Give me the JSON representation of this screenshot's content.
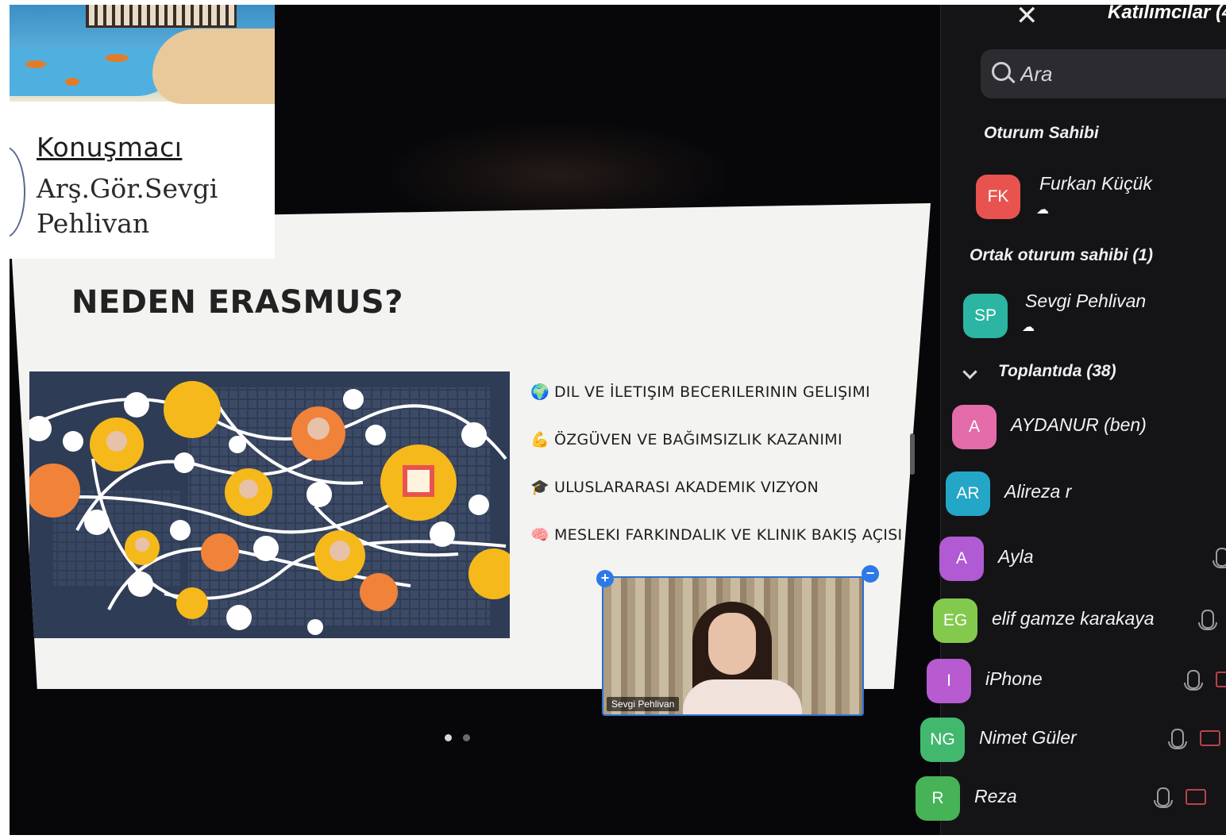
{
  "speaker_card": {
    "label": "Konuşmacı",
    "name": "Arş.Gör.Sevgi Pehlivan"
  },
  "slide": {
    "title": "NEDEN ERASMUS?",
    "bullets": [
      {
        "emoji": "🌍",
        "text": "DIL VE İLETIŞIM BECERILERININ GELIŞIMI"
      },
      {
        "emoji": "💪",
        "text": "ÖZGÜVEN VE BAĞIMSIZLIK KAZANIMI"
      },
      {
        "emoji": "🎓",
        "text": "ULUSLARARASI AKADEMIK VIZYON"
      },
      {
        "emoji": "🧠",
        "text": "MESLEKI FARKINDALIK VE KLINIK BAKIŞ AÇISI"
      }
    ],
    "page_dots": {
      "total": 2,
      "active": 1
    }
  },
  "self_video": {
    "name": "Sevgi Pehlivan",
    "add_glyph": "+",
    "minimize_glyph": "−"
  },
  "participants_panel": {
    "close_glyph": "✕",
    "title": "Katılımcılar (4",
    "search_placeholder": "Ara",
    "host_section": "Oturum Sahibi",
    "cohost_section": "Ortak oturum sahibi (1)",
    "meeting_section": "Toplantıda (38)",
    "host": {
      "initials": "FK",
      "name": "Furkan Küçük",
      "color": "#e8534f"
    },
    "cohost": {
      "initials": "SP",
      "name": "Sevgi Pehlivan",
      "color": "#2bb5a2"
    },
    "members": [
      {
        "initials": "A",
        "name": "AYDANUR (ben)",
        "color": "#e46ba9",
        "mic": false,
        "cam": false
      },
      {
        "initials": "AR",
        "name": "Alireza r",
        "color": "#24a6c6",
        "mic": true,
        "cam": false
      },
      {
        "initials": "A",
        "name": "Ayla",
        "color": "#b05ad3",
        "mic": true,
        "cam": false
      },
      {
        "initials": "EG",
        "name": "elif gamze karakaya",
        "color": "#83c94e",
        "mic": true,
        "cam": false
      },
      {
        "initials": "I",
        "name": "iPhone",
        "color": "#b85ad0",
        "mic": true,
        "cam": true
      },
      {
        "initials": "NG",
        "name": "Nimet Güler",
        "color": "#42b86f",
        "mic": true,
        "cam": true
      },
      {
        "initials": "R",
        "name": "Reza",
        "color": "#46b356",
        "mic": true,
        "cam": true
      }
    ]
  }
}
